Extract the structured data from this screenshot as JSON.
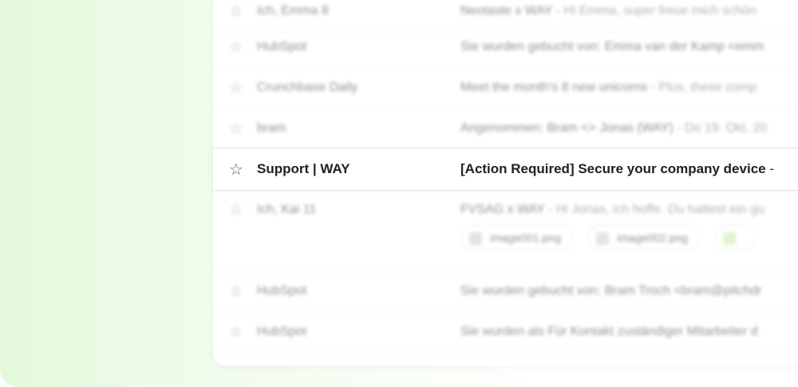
{
  "inbox": {
    "rows": [
      {
        "sender": "Ich, Emma 8",
        "subject": "Neotaste x WAY",
        "snippet": " - Hi Emma, super freue mich schön"
      },
      {
        "sender": "HubSpot",
        "subject": "Sie wurden gebucht von: Emma van der Kamp <emm",
        "snippet": ""
      },
      {
        "sender": "Crunchbase Daily",
        "subject": "Meet the month's 8 new unicorns",
        "snippet": " - Plus, these comp"
      },
      {
        "sender": "bram",
        "subject": "Angenommen: Bram <> Jonas (WAY)",
        "snippet": " - Do 19. Okt. 20"
      },
      {
        "sender": "Ich, Kai 11",
        "subject": "FVSAG x WAY",
        "snippet": " - Hi Jonas, ich hoffe. Du hattest ein gu"
      },
      {
        "sender": "HubSpot",
        "subject": "Sie wurden gebucht von: Bram Troch <bram@pitchdr",
        "snippet": ""
      },
      {
        "sender": "HubSpot",
        "subject": "Sie wurden als Für Kontakt zuständiger Mitarbeiter d",
        "snippet": ""
      }
    ],
    "attachments": [
      "image001.png",
      "image002.png",
      ""
    ],
    "highlighted": {
      "sender": "Support | WAY",
      "subject": "[Action Required] Secure your company device",
      "dash": " -"
    },
    "star_glyph": "☆",
    "colors": {
      "accent_bg": "#e4f9db",
      "text": "#202124",
      "muted": "#5f6368"
    }
  }
}
